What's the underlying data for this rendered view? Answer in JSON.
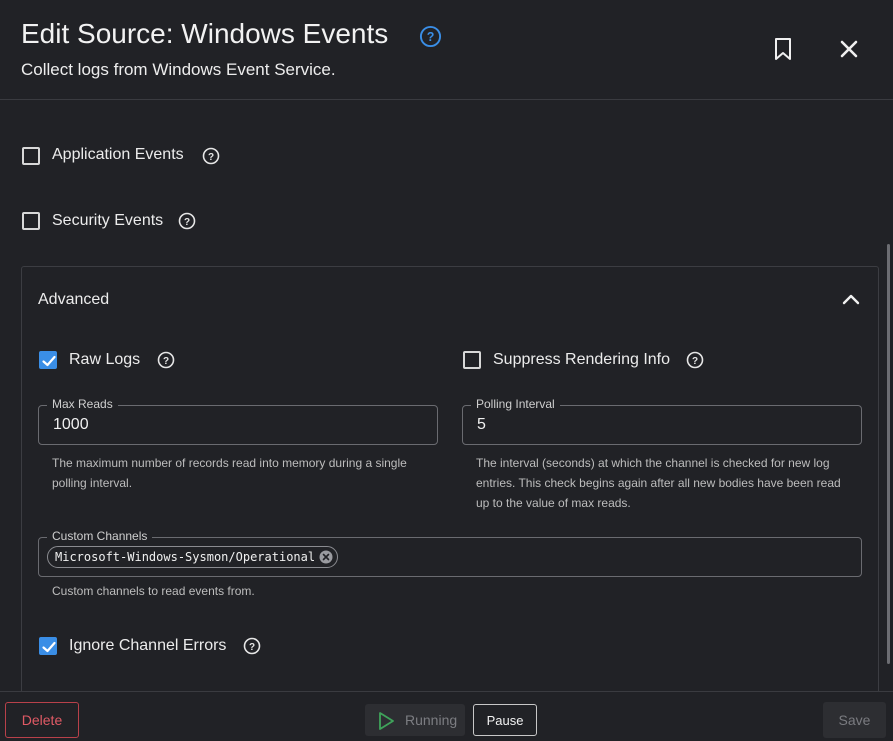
{
  "header": {
    "title": "Edit Source: Windows Events",
    "subtitle": "Collect logs from Windows Event Service.",
    "accent_color": "#3a8ee6"
  },
  "options": {
    "application_events": {
      "label": "Application Events",
      "checked": false
    },
    "security_events": {
      "label": "Security Events",
      "checked": false
    }
  },
  "advanced": {
    "title": "Advanced",
    "expanded": true,
    "raw_logs": {
      "label": "Raw Logs",
      "checked": true
    },
    "suppress_rendering_info": {
      "label": "Suppress Rendering Info",
      "checked": false
    },
    "max_reads": {
      "label": "Max Reads",
      "value": "1000",
      "helper_line1": "The maximum number of records read into memory during a single",
      "helper_line2": "polling interval."
    },
    "polling_interval": {
      "label": "Polling Interval",
      "value": "5",
      "helper_line1": "The interval (seconds) at which the channel is checked for new log",
      "helper_line2": "entries. This check begins again after all new bodies have been read",
      "helper_line3": "up to the value of max reads."
    },
    "custom_channels": {
      "label": "Custom Channels",
      "chips": [
        "Microsoft-Windows-Sysmon/Operational"
      ],
      "helper": "Custom channels to read events from."
    },
    "ignore_channel_errors": {
      "label": "Ignore Channel Errors",
      "checked": true
    }
  },
  "footer": {
    "delete_label": "Delete",
    "running_label": "Running",
    "pause_label": "Pause",
    "save_label": "Save"
  }
}
